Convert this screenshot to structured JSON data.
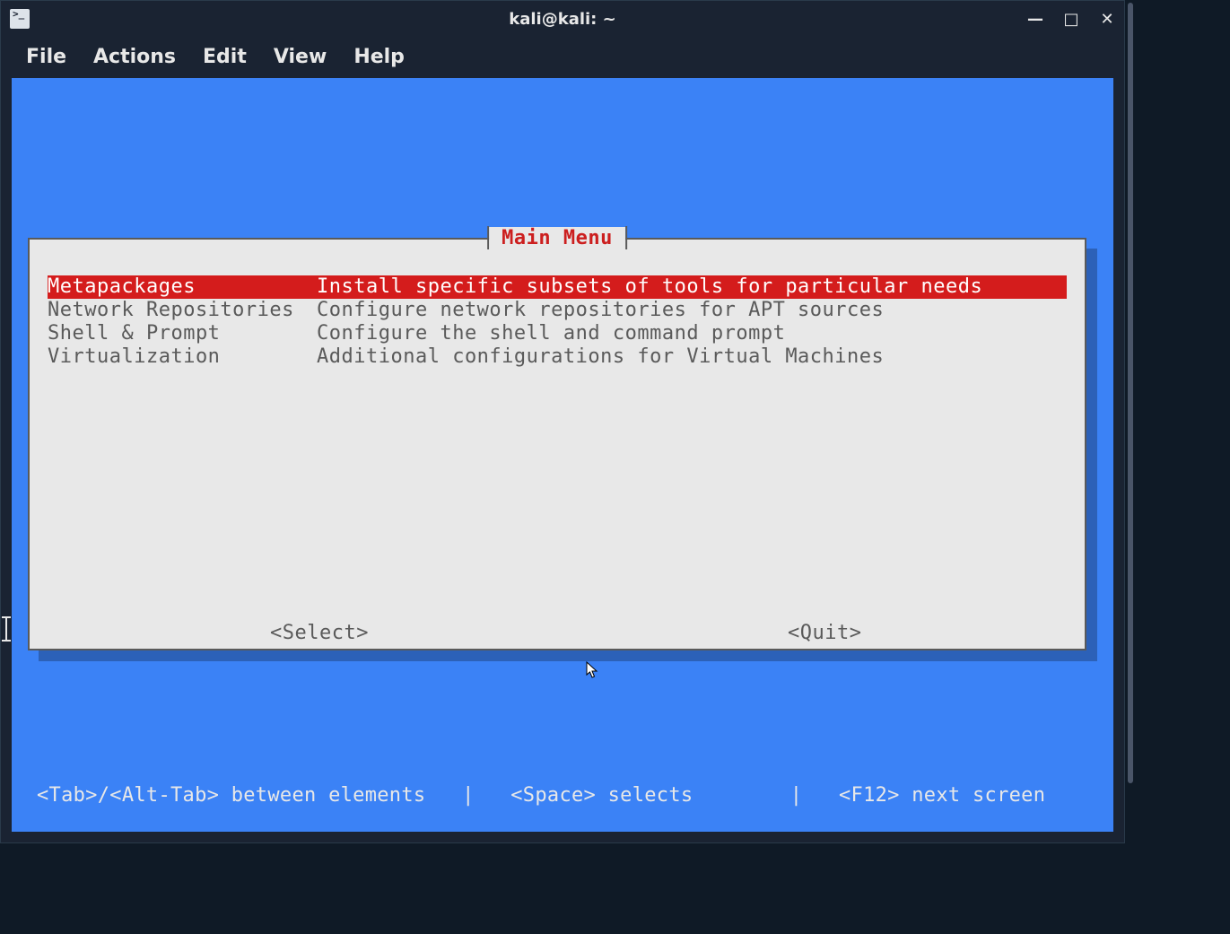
{
  "window": {
    "title": "kali@kali: ~"
  },
  "menubar": {
    "items": [
      "File",
      "Actions",
      "Edit",
      "View",
      "Help"
    ]
  },
  "tui": {
    "title": "Main Menu",
    "items": [
      {
        "name": "Metapackages",
        "desc": "Install specific subsets of tools for particular needs",
        "selected": true
      },
      {
        "name": "Network Repositories",
        "desc": "Configure network repositories for APT sources",
        "selected": false
      },
      {
        "name": "Shell & Prompt",
        "desc": "Configure the shell and command prompt",
        "selected": false
      },
      {
        "name": "Virtualization",
        "desc": "Additional configurations for Virtual Machines",
        "selected": false
      }
    ],
    "buttons": {
      "select": "<Select>",
      "quit": "<Quit>"
    }
  },
  "hints": {
    "text": "<Tab>/<Alt-Tab> between elements   |   <Space> selects        |   <F12> next screen"
  }
}
